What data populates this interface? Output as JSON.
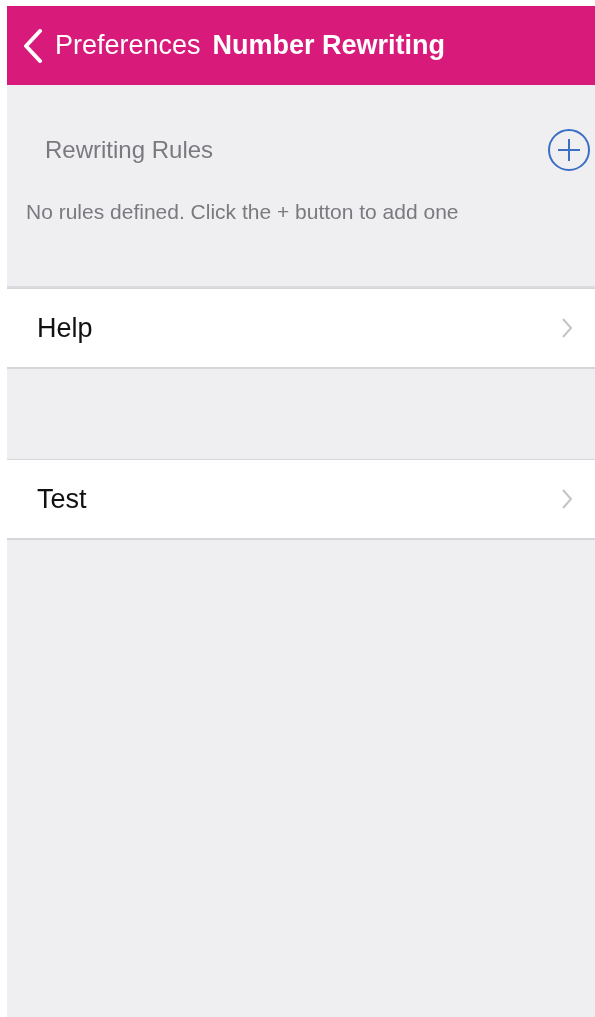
{
  "nav_bar": {
    "back_label": "Preferences",
    "title": "Number Rewriting"
  },
  "rules_section": {
    "title": "Rewriting Rules",
    "empty_message": "No rules defined. Click the + button to add one"
  },
  "menu_groups": [
    [
      {
        "label": "Help"
      }
    ],
    [
      {
        "label": "Test"
      }
    ]
  ]
}
